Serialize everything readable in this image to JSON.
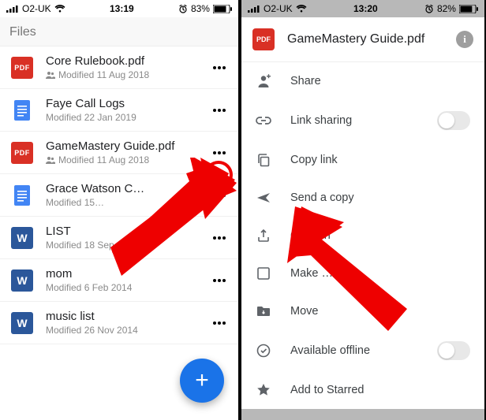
{
  "left": {
    "statusbar": {
      "carrier": "O2-UK",
      "time": "13:19",
      "alarm": true,
      "battery": "83%"
    },
    "header": "Files",
    "files": [
      {
        "icon": "pdf",
        "name": "Core Rulebook.pdf",
        "meta": "Modified 11 Aug 2018",
        "shared": true
      },
      {
        "icon": "doc",
        "name": "Faye Call Logs",
        "meta": "Modified 22 Jan 2019",
        "shared": false
      },
      {
        "icon": "pdf",
        "name": "GameMastery Guide.pdf",
        "meta": "Modified 11 Aug 2018",
        "shared": true
      },
      {
        "icon": "doc",
        "name": "Grace Watson C…",
        "meta": "Modified 15…",
        "shared": false
      },
      {
        "icon": "word",
        "name": "LIST",
        "meta": "Modified 18 Sep 2014",
        "shared": false
      },
      {
        "icon": "word",
        "name": "mom",
        "meta": "Modified 6 Feb 2014",
        "shared": false
      },
      {
        "icon": "word",
        "name": "music list",
        "meta": "Modified 26 Nov 2014",
        "shared": false
      }
    ],
    "fab": "+"
  },
  "right": {
    "statusbar": {
      "carrier": "O2-UK",
      "time": "13:20",
      "alarm": true,
      "battery": "82%"
    },
    "sheet": {
      "badge": "PDF",
      "title": "GameMastery Guide.pdf",
      "items": [
        {
          "icon": "person-add",
          "label": "Share"
        },
        {
          "icon": "link",
          "label": "Link sharing",
          "toggle": true
        },
        {
          "icon": "copy",
          "label": "Copy link"
        },
        {
          "icon": "send",
          "label": "Send a copy"
        },
        {
          "icon": "open-in",
          "label": "Open in"
        },
        {
          "icon": "make",
          "label": "Make …"
        },
        {
          "icon": "move",
          "label": "Move"
        },
        {
          "icon": "offline",
          "label": "Available offline",
          "toggle": true
        },
        {
          "icon": "star",
          "label": "Add to Starred"
        }
      ]
    }
  }
}
